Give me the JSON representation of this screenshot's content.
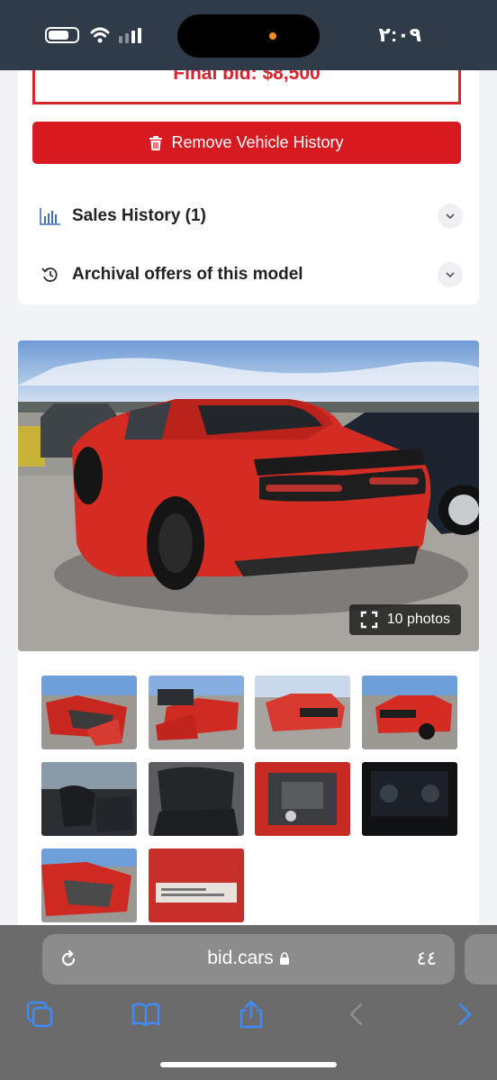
{
  "status_bar": {
    "time": "٢:٠٩"
  },
  "listing": {
    "final_bid_label": "Final bid: $8,500",
    "remove_button_label": "Remove Vehicle History",
    "sales_history_label": "Sales History (1)",
    "archival_label": "Archival offers of this model",
    "photo_count_label": "10 photos"
  },
  "browser": {
    "url": "bid.cars",
    "tab_count": "٤٤"
  },
  "colors": {
    "accent_red": "#d71920",
    "status_bar_bg": "#2f3b48",
    "safari_bar_bg": "#6b6b6b",
    "toolbar_blue": "#3d8cff"
  }
}
